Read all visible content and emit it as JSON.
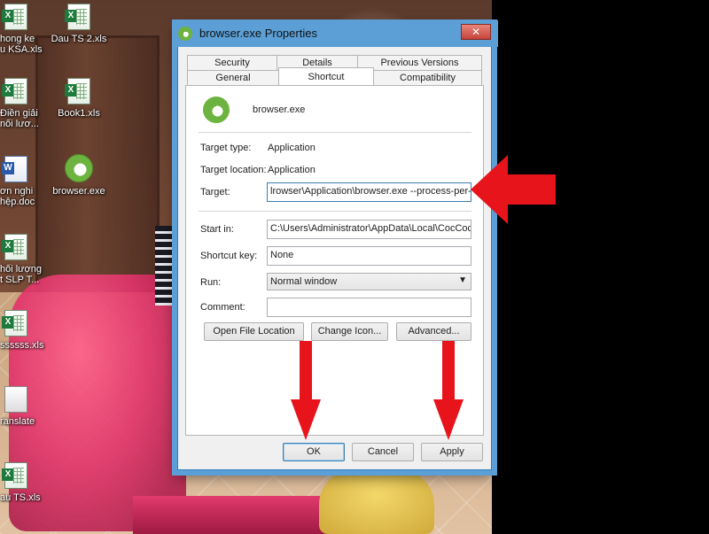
{
  "desktop": {
    "icons": [
      {
        "label": "hong ke\nu KSA.xls",
        "kind": "xls"
      },
      {
        "label": "Dau TS 2.xls",
        "kind": "xls"
      },
      {
        "label": "Điền giải\nnối lươ...",
        "kind": "xls"
      },
      {
        "label": "Book1.xls",
        "kind": "xls"
      },
      {
        "label": "ơn nghi\nhệp.doc",
        "kind": "doc"
      },
      {
        "label": "browser.exe",
        "kind": "app"
      },
      {
        "label": "hối lượng\nt SLP T...",
        "kind": "xls"
      },
      {
        "label": "ssssss.xls",
        "kind": "xls"
      },
      {
        "label": "ranslate",
        "kind": "file"
      },
      {
        "label": "au TS.xls",
        "kind": "xls"
      }
    ]
  },
  "dialog": {
    "title": "browser.exe Properties",
    "close_label": "✕",
    "tabs_back": [
      "Security",
      "Details",
      "Previous Versions"
    ],
    "tabs_front": [
      "General",
      "Shortcut",
      "Compatibility"
    ],
    "active_tab": "Shortcut",
    "app_name": "browser.exe",
    "target_type_label": "Target type:",
    "target_type_value": "Application",
    "target_location_label": "Target location:",
    "target_location_value": "Application",
    "target_label": "Target:",
    "target_value": "lrowser\\Application\\browser.exe --process-per-site",
    "start_in_label": "Start in:",
    "start_in_value": "C:\\Users\\Administrator\\AppData\\Local\\CocCoc\\",
    "shortcut_key_label": "Shortcut key:",
    "shortcut_key_value": "None",
    "run_label": "Run:",
    "run_value": "Normal window",
    "comment_label": "Comment:",
    "comment_value": "",
    "open_file_location": "Open File Location",
    "change_icon": "Change Icon...",
    "advanced": "Advanced...",
    "ok": "OK",
    "cancel": "Cancel",
    "apply": "Apply"
  },
  "colors": {
    "annotation_red": "#e8141c",
    "title_bar": "#5b9fd6",
    "accent_green": "#6db33f"
  }
}
